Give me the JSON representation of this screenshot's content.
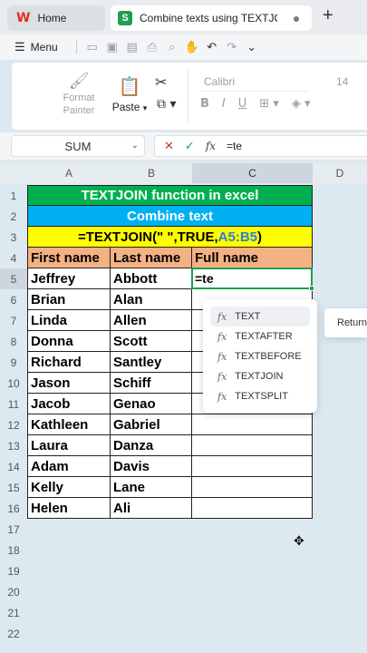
{
  "tabs": {
    "home_label": "Home",
    "doc_label": "Combine texts using TEXTJOIN",
    "new_tab": "+"
  },
  "menu": {
    "menu_label": "Menu"
  },
  "ribbon": {
    "format_painter_line1": "Format",
    "format_painter_line2": "Painter",
    "paste_label": "Paste",
    "font_name": "Calibri",
    "font_size": "14"
  },
  "formula_bar": {
    "name_box": "SUM",
    "formula": "=te"
  },
  "grid": {
    "columns": [
      "A",
      "B",
      "C",
      "D"
    ],
    "rows": [
      "1",
      "2",
      "3",
      "4",
      "5",
      "6",
      "7",
      "8",
      "9",
      "10",
      "11",
      "12",
      "13",
      "14",
      "15",
      "16",
      "17",
      "18",
      "19",
      "20",
      "21",
      "22"
    ],
    "title": "TEXTJOIN function in excel",
    "subtitle": "Combine text",
    "formula_prefix": "=TEXTJOIN(\" \",TRUE,",
    "formula_range": "A5:B5",
    "formula_suffix": ")",
    "header_first": "First name",
    "header_last": "Last name",
    "header_full": "Full name",
    "active_cell_text": "=te",
    "people": [
      {
        "first": "Jeffrey",
        "last": "Abbott"
      },
      {
        "first": "Brian",
        "last": "Alan"
      },
      {
        "first": "Linda",
        "last": "Allen"
      },
      {
        "first": "Donna",
        "last": "Scott"
      },
      {
        "first": "Richard",
        "last": "Santley"
      },
      {
        "first": "Jason",
        "last": "Schiff"
      },
      {
        "first": "Jacob",
        "last": "Genao"
      },
      {
        "first": "Kathleen",
        "last": "Gabriel"
      },
      {
        "first": "Laura",
        "last": "Danza"
      },
      {
        "first": "Adam",
        "last": "Davis"
      },
      {
        "first": "Kelly",
        "last": "Lane"
      },
      {
        "first": "Helen",
        "last": "Ali"
      }
    ]
  },
  "autocomplete": {
    "items": [
      "TEXT",
      "TEXTAFTER",
      "TEXTBEFORE",
      "TEXTJOIN",
      "TEXTSPLIT"
    ],
    "tooltip": "Returns"
  },
  "colors": {
    "title_bg": "#00b050",
    "subtitle_bg": "#00b0f0",
    "formula_bg": "#ffff00",
    "header_bg": "#f4b183",
    "accent": "#1f9e50"
  }
}
